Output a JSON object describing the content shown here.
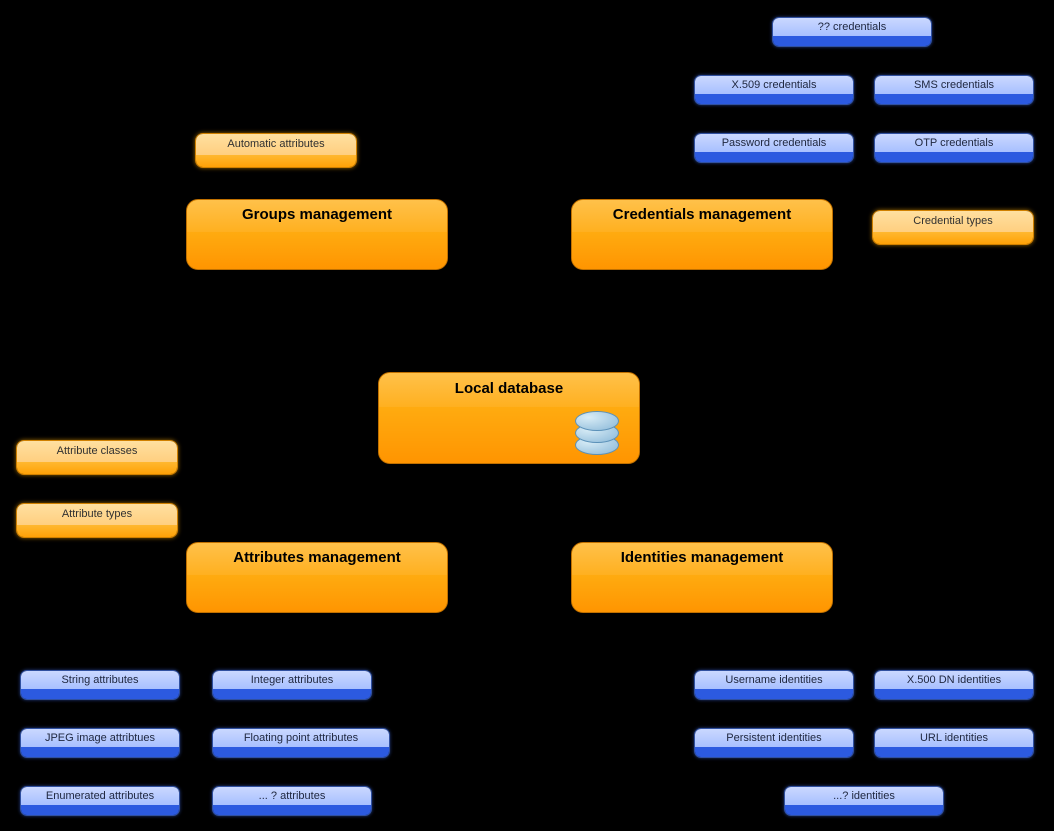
{
  "center": {
    "title": "Local database"
  },
  "big": {
    "groups": "Groups management",
    "credentials": "Credentials management",
    "attributes": "Attributes management",
    "identities": "Identities management"
  },
  "small_orange": {
    "auto_attr": "Automatic attributes",
    "cred_types": "Credential types",
    "attr_classes": "Attribute classes",
    "attr_types": "Attribute types"
  },
  "creds": {
    "unknown": "?? credentials",
    "x509": "X.509 credentials",
    "sms": "SMS credentials",
    "pwd": "Password credentials",
    "otp": "OTP credentials"
  },
  "attrs": {
    "string": "String attributes",
    "integer": "Integer attributes",
    "jpeg": "JPEG image attribtues",
    "float": "Floating point attributes",
    "enum": "Enumerated attributes",
    "more": "... ? attributes"
  },
  "idents": {
    "username": "Username identities",
    "x500": "X.500 DN identities",
    "persistent": "Persistent identities",
    "url": "URL identities",
    "more": "...? identities"
  }
}
